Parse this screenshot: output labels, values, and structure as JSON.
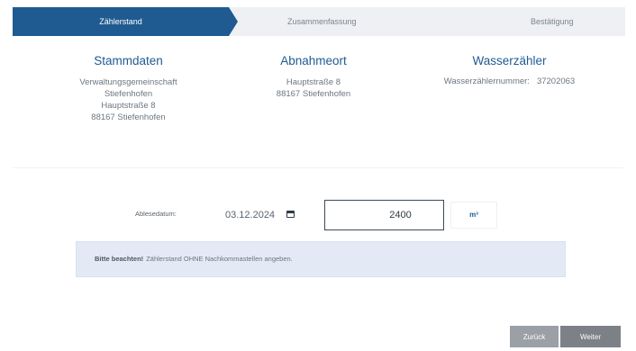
{
  "stepper": {
    "steps": [
      {
        "label": "Zählerstand",
        "active": true
      },
      {
        "label": "Zusammenfassung",
        "active": false
      },
      {
        "label": "Bestätigung",
        "active": false
      }
    ]
  },
  "master_data": {
    "title": "Stammdaten",
    "lines": [
      "Verwaltungsgemeinschaft",
      "Stiefenhofen",
      "Hauptstraße 8",
      "88167 Stiefenhofen"
    ]
  },
  "location": {
    "title": "Abnahmeort",
    "lines": [
      "Hauptstraße 8",
      "88167 Stiefenhofen"
    ]
  },
  "meter": {
    "title": "Wasserzähler",
    "number_label": "Wasserzählernummer:",
    "number_value": "37202063"
  },
  "form": {
    "date_label": "Ablesedatum:",
    "date_value": "03.12.2024",
    "reading_value": "2400",
    "unit": "m³"
  },
  "notice": {
    "bold": "Bitte beachten!",
    "text": "Zählerstand OHNE Nachkommastellen angeben."
  },
  "buttons": {
    "back": "Zurück",
    "next": "Weiter"
  },
  "colors": {
    "accent": "#1f5b91",
    "notice_bg": "#e3eaf5",
    "button_back": "#9aa0a6",
    "button_next": "#7b8187"
  }
}
